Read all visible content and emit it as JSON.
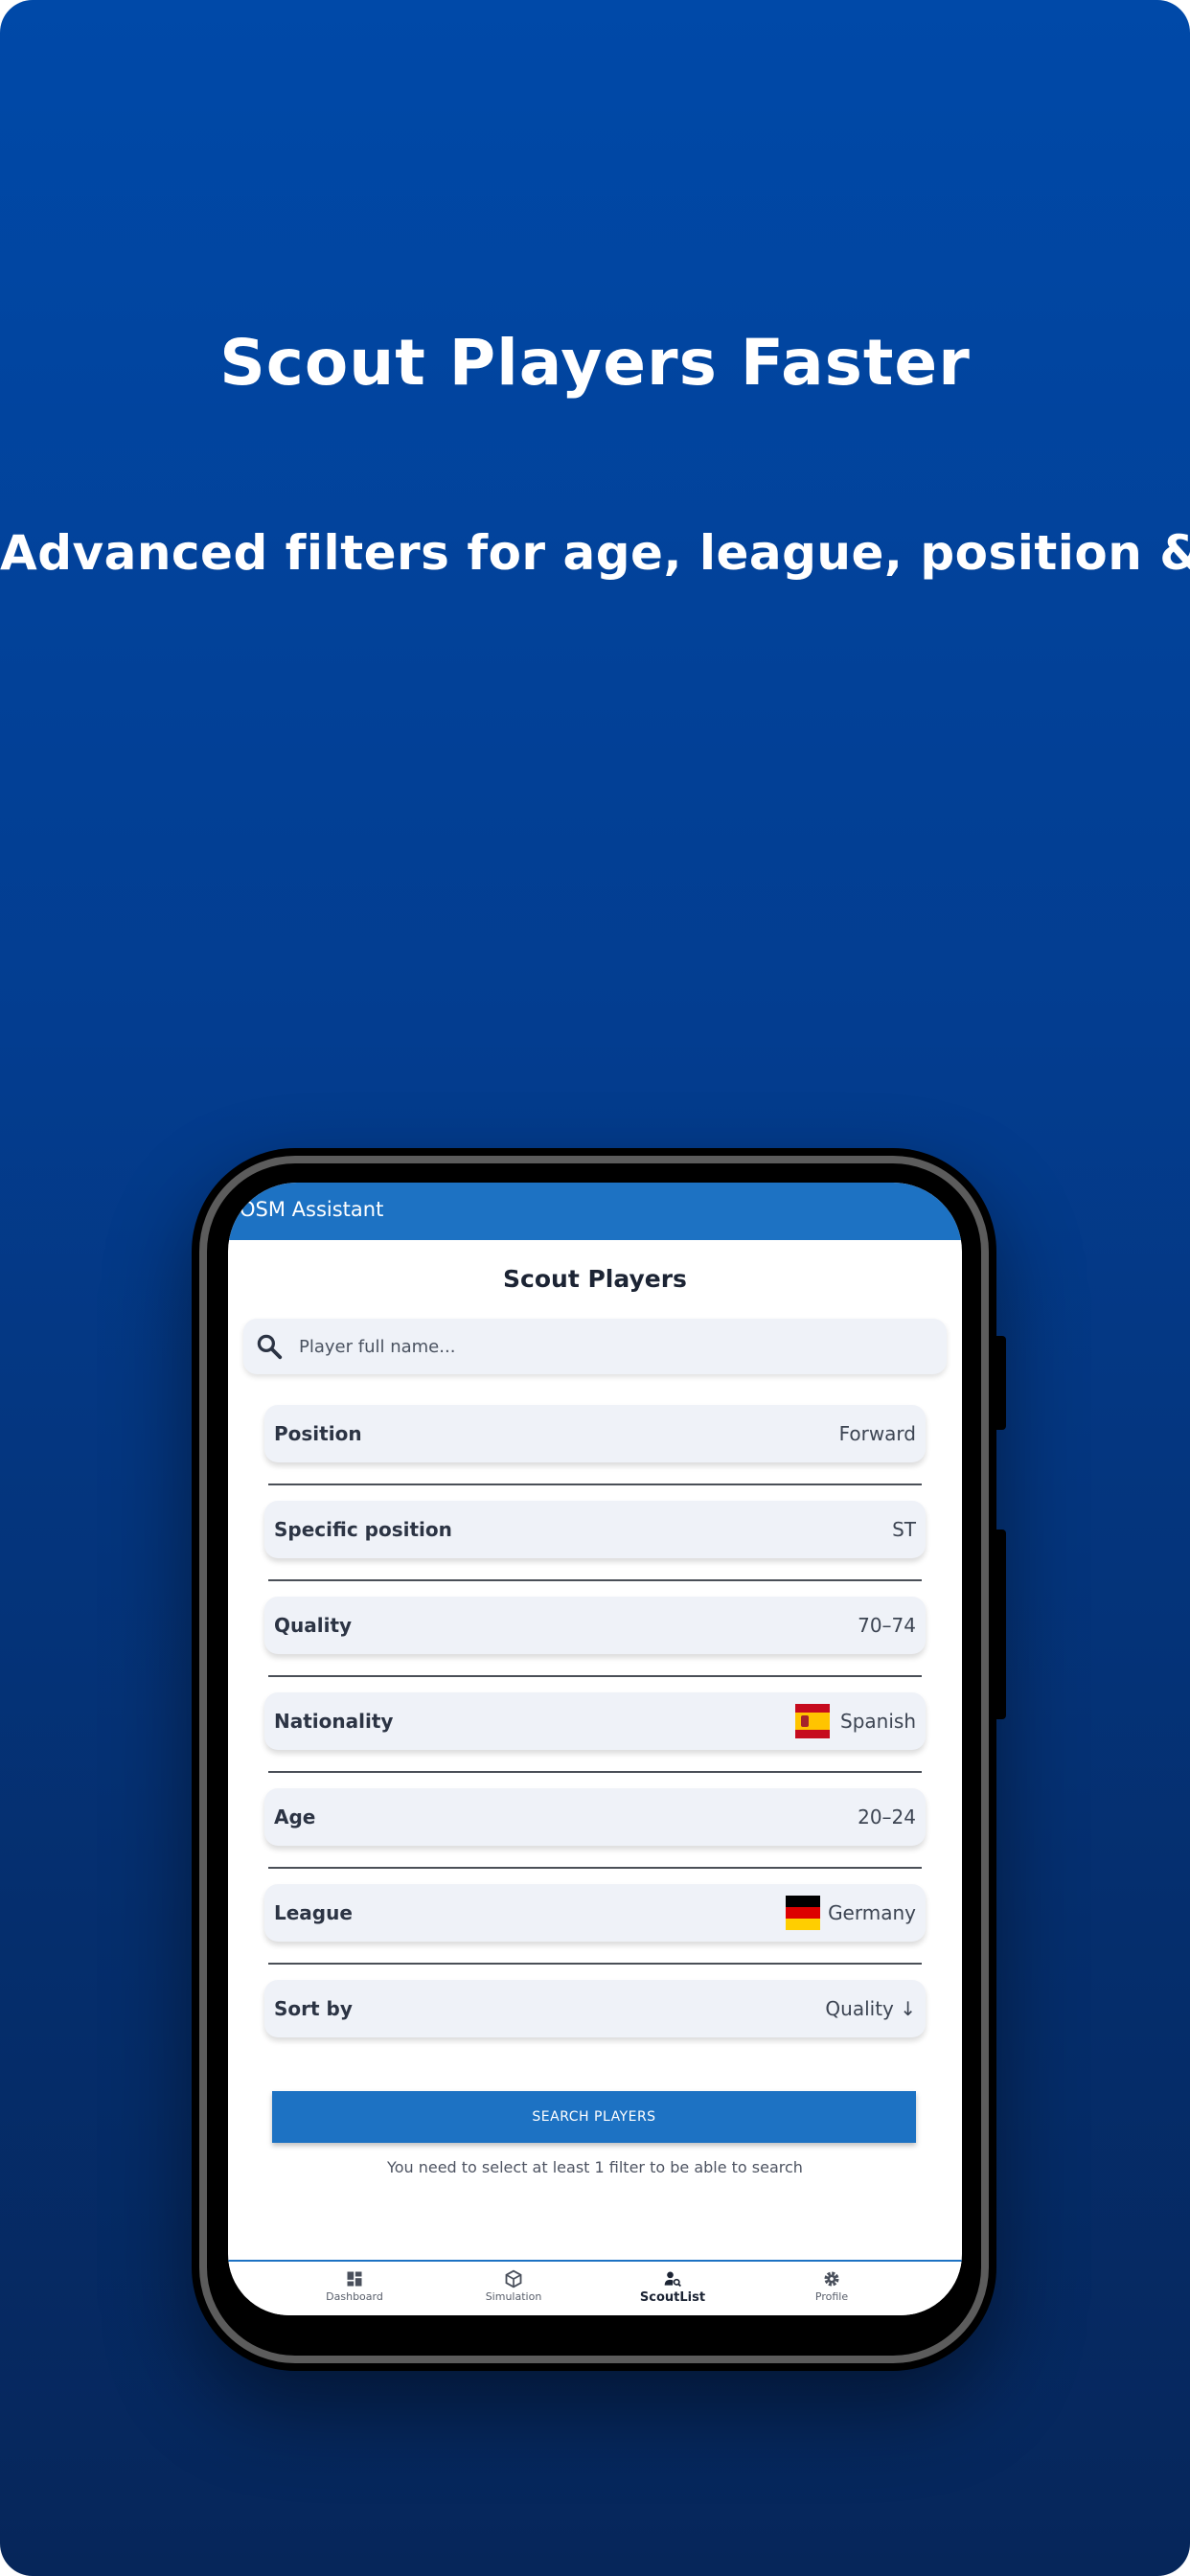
{
  "promo": {
    "headline": "Scout Players Faster",
    "subline": "Advanced filters for age, league, position & more"
  },
  "app": {
    "title": "OSM Assistant",
    "screen_title": "Scout Players",
    "search": {
      "placeholder": "Player full name...",
      "value": "",
      "icon": "search-icon"
    },
    "filters": [
      {
        "label": "Position",
        "value": "Forward"
      },
      {
        "label": "Specific position",
        "value": "ST"
      },
      {
        "label": "Quality",
        "value": "70–74"
      },
      {
        "label": "Nationality",
        "value": "Spanish",
        "flag": "spain-flag-icon"
      },
      {
        "label": "Age",
        "value": "20–24"
      },
      {
        "label": "League",
        "value": "Germany",
        "flag": "germany-flag-icon"
      },
      {
        "label": "Sort by",
        "value": "Quality ↓"
      }
    ],
    "search_button": "SEARCH PLAYERS",
    "helper_text": "You need to select at least 1 filter to be able to search",
    "nav": [
      {
        "label": "Dashboard",
        "icon": "dashboard-icon"
      },
      {
        "label": "Simulation",
        "icon": "cube-icon"
      },
      {
        "label": "ScoutList",
        "icon": "person-search-icon",
        "active": true
      },
      {
        "label": "Profile",
        "icon": "gear-icon"
      }
    ]
  },
  "colors": {
    "background_top": "#0049a8",
    "background_bottom": "#06265a",
    "primary": "#1d72c3",
    "card": "#eff2f8"
  }
}
